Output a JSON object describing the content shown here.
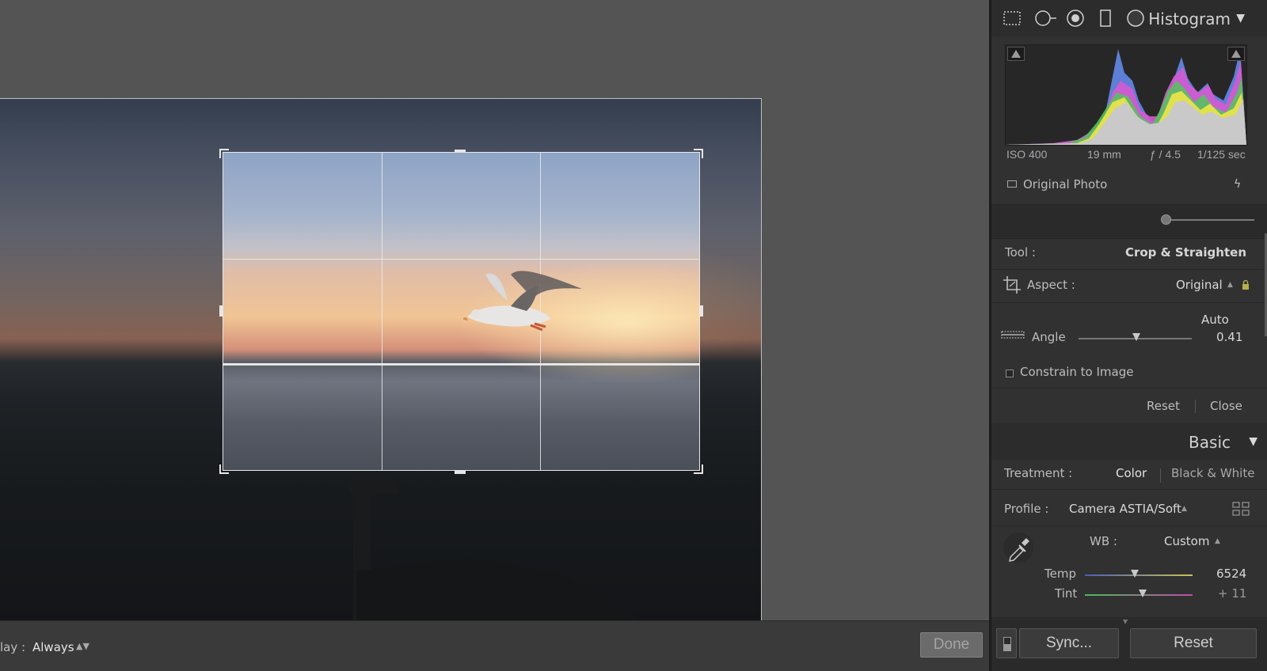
{
  "canvas": {
    "overlay_label": "lay :",
    "overlay_value": "Always",
    "done_label": "Done"
  },
  "histogram": {
    "title": "Histogram",
    "iso": "ISO 400",
    "focal": "19 mm",
    "aperture": "ƒ / 4.5",
    "shutter": "1/125 sec",
    "original_photo_label": "Original Photo"
  },
  "crop": {
    "tool_label": "Tool :",
    "tool_value": "Crop & Straighten",
    "aspect_label": "Aspect :",
    "aspect_value": "Original",
    "auto_label": "Auto",
    "angle_label": "Angle",
    "angle_value": "0.41",
    "constrain_label": "Constrain to Image",
    "reset_label": "Reset",
    "close_label": "Close"
  },
  "basic": {
    "title": "Basic",
    "treatment_label": "Treatment :",
    "treatment_color": "Color",
    "treatment_bw": "Black & White",
    "profile_label": "Profile :",
    "profile_value": "Camera ASTIA/Soft",
    "wb_label": "WB :",
    "wb_value": "Custom",
    "temp_label": "Temp",
    "temp_value": "6524",
    "tint_label": "Tint",
    "tint_value": "+ 11"
  },
  "footer": {
    "sync_label": "Sync...",
    "reset_label": "Reset"
  },
  "colors": {
    "panel_bg": "#313131",
    "canvas_bg": "#545454"
  }
}
